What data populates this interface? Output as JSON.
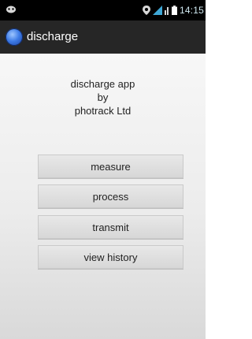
{
  "status_bar": {
    "time": "14:15",
    "icons": [
      "notification-icon",
      "location-icon",
      "network-icon",
      "signal-icon",
      "battery-icon"
    ]
  },
  "action_bar": {
    "title": "discharge",
    "logo_icon": "app-logo-icon"
  },
  "main": {
    "lines": [
      "discharge app",
      "by",
      "photrack Ltd"
    ],
    "buttons": [
      "measure",
      "process",
      "transmit",
      "view history"
    ]
  },
  "colors": {
    "status_bar": "#000000",
    "action_bar": "#262626",
    "button": "#dddddd"
  }
}
